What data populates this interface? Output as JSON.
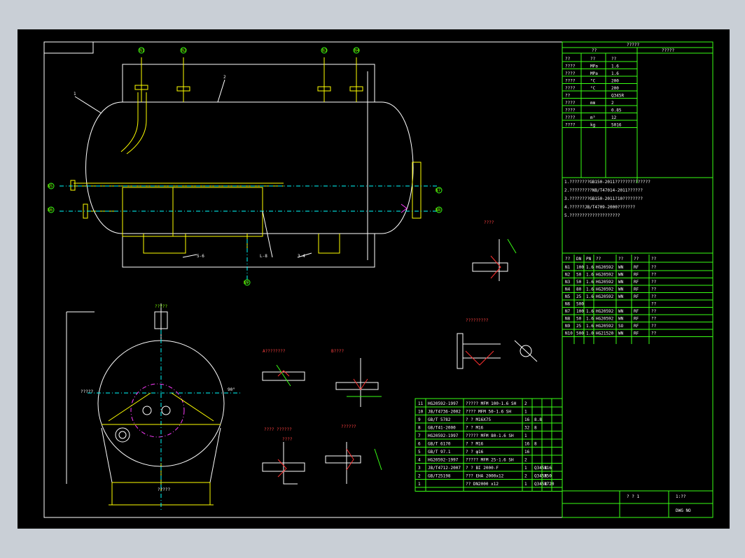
{
  "title_block": {
    "header": "?????",
    "sub_left": "??",
    "sub_right": "?????",
    "scale": "1:??",
    "sheet": "? ? 1",
    "code": "DWG NO"
  },
  "nozzle_labels": [
    "N1",
    "N2",
    "N3",
    "N4",
    "N5",
    "N6",
    "N7",
    "N8",
    "N9",
    "N10"
  ],
  "nozzle_table": {
    "headers": [
      "??",
      "DN",
      "PN",
      "??",
      "??",
      "??",
      "??"
    ],
    "rows": [
      [
        "N1",
        "100",
        "1.6",
        "HG20592",
        "WN",
        "RF",
        "??"
      ],
      [
        "N2",
        "50",
        "1.6",
        "HG20592",
        "WN",
        "RF",
        "??"
      ],
      [
        "N3",
        "50",
        "1.6",
        "HG20592",
        "WN",
        "RF",
        "??"
      ],
      [
        "N4",
        "80",
        "1.6",
        "HG20592",
        "WN",
        "RF",
        "??"
      ],
      [
        "N5",
        "25",
        "1.6",
        "HG20592",
        "WN",
        "RF",
        "??"
      ],
      [
        "N6",
        "500",
        "",
        "",
        "",
        "",
        "??"
      ],
      [
        "N7",
        "100",
        "1.6",
        "HG20592",
        "WN",
        "RF",
        "??"
      ],
      [
        "N8",
        "50",
        "1.6",
        "HG20592",
        "WN",
        "RF",
        "??"
      ],
      [
        "N9",
        "25",
        "1.6",
        "HG20592",
        "SO",
        "RF",
        "??"
      ],
      [
        "N10",
        "500",
        "1.0",
        "HG21520",
        "WN",
        "RF",
        "??"
      ]
    ]
  },
  "parts_list": {
    "rows": [
      [
        "11",
        "HG20592-1997",
        "????? MFM 100-1.6 SH",
        "2",
        "",
        "",
        ""
      ],
      [
        "10",
        "JB/T4736-2002",
        "???? MFM 50-1.6 SH",
        "1",
        "",
        "",
        ""
      ],
      [
        "9",
        "GB/T 5782",
        "? ? M16X75",
        "16",
        "8.8",
        "",
        ""
      ],
      [
        "8",
        "GB/T41-2000",
        "? ? M16",
        "32",
        "8",
        "",
        ""
      ],
      [
        "7",
        "HG20592-1997",
        "????? MFM 80-1.6 SH",
        "1",
        "",
        "",
        ""
      ],
      [
        "6",
        "GB/T 6170",
        "? ? M16",
        "16",
        "8",
        "",
        ""
      ],
      [
        "5",
        "GB/T 97.1",
        "? ? φ16",
        "16",
        "",
        "",
        ""
      ],
      [
        "4",
        "HG20592-1997",
        "????? MFM 25-1.6 SH",
        "2",
        "",
        "",
        ""
      ],
      [
        "3",
        "JB/T4712-2007",
        "? ? BI 2000-F",
        "1",
        "Q345R",
        "116",
        ""
      ],
      [
        "2",
        "GB/T25198",
        "??? EHA 2000x12",
        "2",
        "Q345R",
        "350",
        ""
      ],
      [
        "1",
        "",
        "?? DN2000 x12",
        "1",
        "Q345R",
        "1720",
        ""
      ]
    ]
  },
  "spec_rows": [
    [
      "??",
      "??",
      "??"
    ],
    [
      "????",
      "MPa",
      "1.6"
    ],
    [
      "????",
      "MPa",
      "1.6"
    ],
    [
      "????",
      "°C",
      "200"
    ],
    [
      "????",
      "°C",
      "200"
    ],
    [
      "??",
      "",
      "Q345R"
    ],
    [
      "????",
      "mm",
      "2"
    ],
    [
      "????",
      "",
      "0.85"
    ],
    [
      "????",
      "m³",
      "12"
    ],
    [
      "????",
      "kg",
      "5016"
    ]
  ],
  "notes": [
    "1.????????GB150-2011??????????????",
    "2.?????????NB/T47014-2011??????",
    "3.????????GB150-2011?10????????",
    "4.??????JB/T4709-2000???????",
    "5.????????????????????"
  ],
  "detail_labels": {
    "detail_a": "A????????",
    "detail_b": "B????",
    "detail_c": "????",
    "detail_d": "??????",
    "detail_e": "????",
    "detail_f": "?????????",
    "red_note": "???? ??????"
  },
  "dims": {
    "elev": "?????",
    "dim_right": "90°",
    "dim_left": "?????"
  }
}
